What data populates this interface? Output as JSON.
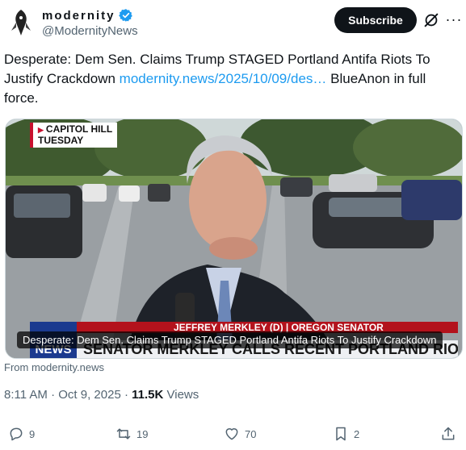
{
  "author": {
    "display_name": "modernity",
    "handle": "@ModernityNews",
    "verified": true
  },
  "header_actions": {
    "subscribe_label": "Subscribe",
    "more_label": "···"
  },
  "tweet": {
    "text_before_link": "Desperate: Dem Sen. Claims Trump STAGED Portland Antifa Riots To Justify Crackdown ",
    "link_text": "modernity.news/2025/10/09/des…",
    "text_after_link": " BlueAnon in full force."
  },
  "media": {
    "location_tag_line1": "CAPITOL HILL",
    "location_tag_line2": "TUESDAY",
    "caption": "Desperate: Dem Sen. Claims Trump STAGED Portland Antifa Riots To Justify Crackdown",
    "chyron_name": "JEFFREY MERKLEY (D) | OREGON SENATOR",
    "chyron_headline": "SENATOR MERKLEY CALLS RECENT PORTLAND RIOTS STAGED",
    "logo_text": "NEWS"
  },
  "card_source": "From modernity.news",
  "meta": {
    "time_date": "8:11 AM · Oct 9, 2025 · ",
    "views_count": "11.5K",
    "views_label": " Views"
  },
  "actions": {
    "replies": "9",
    "reposts": "19",
    "likes": "70",
    "bookmarks": "2"
  },
  "colors": {
    "link": "#1d9bf0",
    "verified": "#1d9bf0",
    "secondary_text": "#536471",
    "primary_text": "#0f1419"
  }
}
